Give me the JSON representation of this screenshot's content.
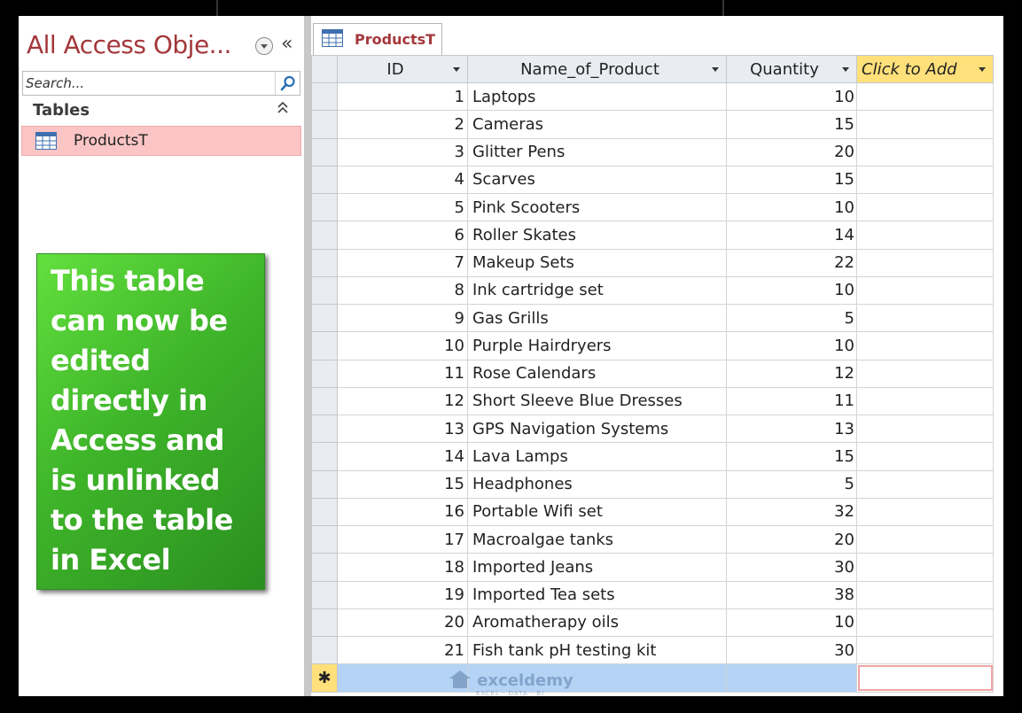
{
  "nav_pane": {
    "title": "All Access Obje...",
    "collapse_glyph": "«",
    "search_placeholder": "Search...",
    "group_label": "Tables",
    "group_chevron": "⌃",
    "items": [
      {
        "label": "ProductsT",
        "icon": "table-icon"
      }
    ]
  },
  "callout": {
    "text": "This table can now be edited directly in Access and is unlinked to the table in Excel",
    "color": "#3fb52a"
  },
  "document_tab": {
    "label": "ProductsT",
    "icon": "table-icon"
  },
  "datasheet": {
    "columns": [
      "ID",
      "Name_of_Product",
      "Quantity",
      "Click to Add"
    ],
    "rows": [
      {
        "id": "1",
        "name": "Laptops",
        "qty": "10"
      },
      {
        "id": "2",
        "name": "Cameras",
        "qty": "15"
      },
      {
        "id": "3",
        "name": "Glitter Pens",
        "qty": "20"
      },
      {
        "id": "4",
        "name": "Scarves",
        "qty": "15"
      },
      {
        "id": "5",
        "name": "Pink Scooters",
        "qty": "10"
      },
      {
        "id": "6",
        "name": "Roller Skates",
        "qty": "14"
      },
      {
        "id": "7",
        "name": "Makeup Sets",
        "qty": "22"
      },
      {
        "id": "8",
        "name": "Ink cartridge set",
        "qty": "10"
      },
      {
        "id": "9",
        "name": "Gas Grills",
        "qty": "5"
      },
      {
        "id": "10",
        "name": "Purple Hairdryers",
        "qty": "10"
      },
      {
        "id": "11",
        "name": "Rose Calendars",
        "qty": "12"
      },
      {
        "id": "12",
        "name": "Short Sleeve Blue Dresses",
        "qty": "11"
      },
      {
        "id": "13",
        "name": "GPS Navigation Systems",
        "qty": "13"
      },
      {
        "id": "14",
        "name": "Lava Lamps",
        "qty": "15"
      },
      {
        "id": "15",
        "name": "Headphones",
        "qty": "5"
      },
      {
        "id": "16",
        "name": "Portable Wifi set",
        "qty": "32"
      },
      {
        "id": "17",
        "name": "Macroalgae tanks",
        "qty": "20"
      },
      {
        "id": "18",
        "name": "Imported Jeans",
        "qty": "30"
      },
      {
        "id": "19",
        "name": "Imported Tea sets",
        "qty": "38"
      },
      {
        "id": "20",
        "name": "Aromatherapy oils",
        "qty": "10"
      },
      {
        "id": "21",
        "name": "Fish tank pH testing kit",
        "qty": "30"
      }
    ],
    "new_record_glyph": "✱",
    "add_column_color": "#ffe07a",
    "new_row_color": "#b4d3f5"
  },
  "watermark": {
    "text": "exceldemy",
    "subtext": "EXCEL · DATA · BI"
  }
}
